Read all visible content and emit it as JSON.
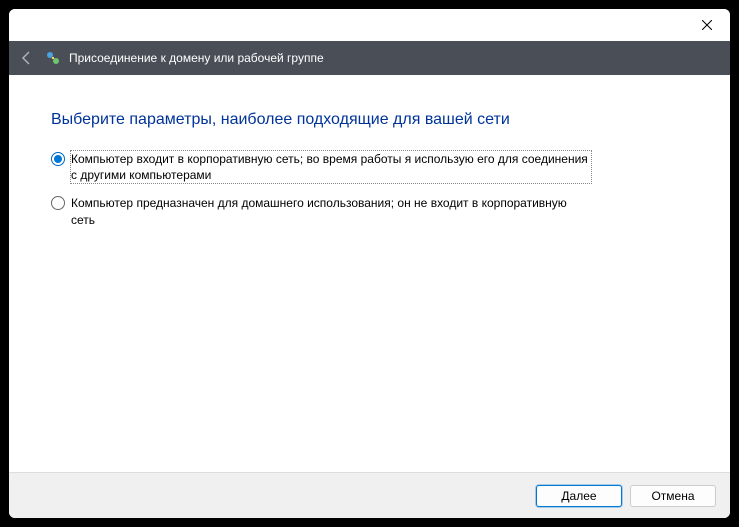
{
  "header": {
    "title": "Присоединение к домену или рабочей группе"
  },
  "content": {
    "heading": "Выберите параметры, наиболее подходящие для вашей сети",
    "options": [
      {
        "label": "Компьютер входит в корпоративную сеть; во время работы я использую его для соединения с другими компьютерами",
        "selected": true
      },
      {
        "label": "Компьютер предназначен для домашнего использования; он не входит в корпоративную сеть",
        "selected": false
      }
    ]
  },
  "footer": {
    "next": "Далее",
    "cancel": "Отмена"
  }
}
